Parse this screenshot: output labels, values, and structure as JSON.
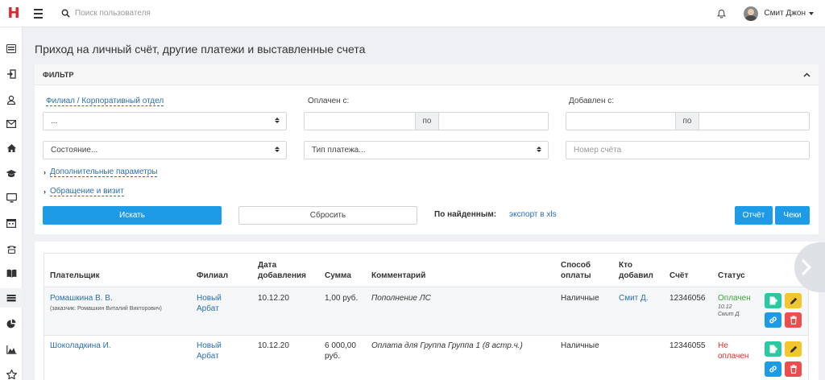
{
  "app": {
    "logo": "H"
  },
  "header": {
    "search_placeholder": "Поиск пользователя",
    "user_name": "Смит Джон"
  },
  "sidebar": {
    "items": [
      "list-icon",
      "login-icon",
      "user-icon",
      "mail-icon",
      "home-icon",
      "graduation-cap-icon",
      "monitor-icon",
      "calendar-icon",
      "phone-icon",
      "book-icon",
      "wallet-icon",
      "pie-chart-icon",
      "area-chart-icon",
      "star-icon"
    ],
    "active": "wallet-icon"
  },
  "page": {
    "title": "Приход на личный счёт, другие платежи и выставленные счета"
  },
  "filter": {
    "title": "ФИЛЬТР",
    "branch_label": "Филиал / Корпоративный отдел",
    "branch_value": "...",
    "paid_from_label": "Оплачен с:",
    "added_from_label": "Добавлен с:",
    "range_to": "по",
    "state_placeholder": "Состояние...",
    "payment_type_placeholder": "Тип платежа...",
    "invoice_number_placeholder": "Номер счёта",
    "extra_params": "Дополнительные параметры",
    "appeal_visit": "Обращение и визит",
    "search_button": "Искать",
    "reset_button": "Сбросить",
    "by_found_label": "По найденным:",
    "export_link": "экспорт в xls",
    "report_button": "Отчёт",
    "receipts_button": "Чеки"
  },
  "table": {
    "headers": {
      "payer": "Плательщик",
      "branch": "Филиал",
      "date_added": [
        "Дата",
        "добавления"
      ],
      "amount": "Сумма",
      "comment": "Комментарий",
      "payment_method": [
        "Способ",
        "оплаты"
      ],
      "added_by": [
        "Кто",
        "добавил"
      ],
      "invoice": "Счёт",
      "status": "Статус"
    },
    "rows": [
      {
        "payer": "Ромашкина В. В.",
        "payer_note": "(заказчик: Ромашкин Виталий Викторович)",
        "branch": [
          "Новый",
          "Арбат"
        ],
        "date": "10.12.20",
        "amount": "1,00 руб.",
        "comment": "Пополнение ЛС",
        "method": "Наличные",
        "added_by": "Смит Д.",
        "invoice": "12346056",
        "status": "Оплачен",
        "status_date": "10.12",
        "status_by": "Смит Д."
      },
      {
        "payer": "Шоколадкина И.",
        "payer_note": "",
        "branch": [
          "Новый",
          "Арбат"
        ],
        "amount_lines": [
          "6 000,00",
          "руб."
        ],
        "date": "10.12.20",
        "comment": "Оплата для Группа Группа 1 (8 астр.ч.)",
        "method": "Наличные",
        "added_by": "",
        "invoice": "12346055",
        "status_lines": [
          "Не",
          "оплачен"
        ]
      }
    ]
  },
  "colors": {
    "primary": "#1e9be6",
    "link": "#2a6fb0",
    "paid": "#3aa33a",
    "unpaid": "#d9302c",
    "action_green": "#2bc9a1",
    "action_yellow": "#f3c62e",
    "action_red": "#ec4d4d",
    "logo_red": "#e8202a"
  },
  "icons": {
    "menu": "hamburger-icon",
    "search": "search-icon",
    "notifications": "bell-icon",
    "collapse": "chevron-up-icon",
    "expand": "chevron-right-icon",
    "row_actions": [
      "receipt-icon",
      "pencil-icon",
      "link-icon",
      "trash-icon"
    ],
    "next": "chevron-right-icon"
  }
}
